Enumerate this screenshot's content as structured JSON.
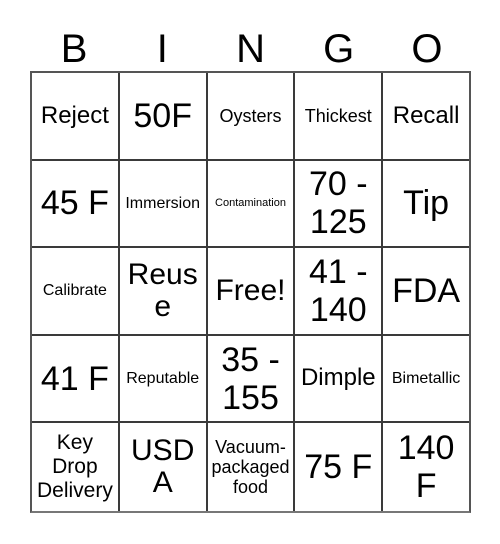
{
  "card": {
    "title_letters": [
      "B",
      "I",
      "N",
      "G",
      "O"
    ],
    "columns": 5,
    "rows": 5,
    "free_space": "Free!",
    "border_color": "#3a3a3a",
    "background_color": "#ffffff",
    "text_color": "#000000",
    "cells": [
      [
        {
          "text": "Reject",
          "size": "fs-lg"
        },
        {
          "text": "50F",
          "size": "fs-xxl"
        },
        {
          "text": "Oysters",
          "size": "fs-smd"
        },
        {
          "text": "Thickest",
          "size": "fs-smd"
        },
        {
          "text": "Recall",
          "size": "fs-lg"
        }
      ],
      [
        {
          "text": "45 F",
          "size": "fs-xxl"
        },
        {
          "text": "Immersion",
          "size": "fs-sm"
        },
        {
          "text": "Contamination",
          "size": "fs-xs"
        },
        {
          "text": "70 - 125",
          "size": "fs-xxl"
        },
        {
          "text": "Tip",
          "size": "fs-xxl"
        }
      ],
      [
        {
          "text": "Calibrate",
          "size": "fs-sm"
        },
        {
          "text": "Reuse",
          "size": "fs-xl"
        },
        {
          "text": "Free!",
          "size": "fs-xl"
        },
        {
          "text": "41 - 140",
          "size": "fs-xxl"
        },
        {
          "text": "FDA",
          "size": "fs-xxl"
        }
      ],
      [
        {
          "text": "41 F",
          "size": "fs-xxl"
        },
        {
          "text": "Reputable",
          "size": "fs-sm"
        },
        {
          "text": "35 - 155",
          "size": "fs-xxl"
        },
        {
          "text": "Dimple",
          "size": "fs-lg"
        },
        {
          "text": "Bimetallic",
          "size": "fs-sm"
        }
      ],
      [
        {
          "text": "Key Drop Delivery",
          "size": "fs-md"
        },
        {
          "text": "USDA",
          "size": "fs-xl"
        },
        {
          "text": "Vacuum-packaged food",
          "size": "fs-smd"
        },
        {
          "text": "75 F",
          "size": "fs-xxl"
        },
        {
          "text": "140 F",
          "size": "fs-xxl"
        }
      ]
    ]
  }
}
